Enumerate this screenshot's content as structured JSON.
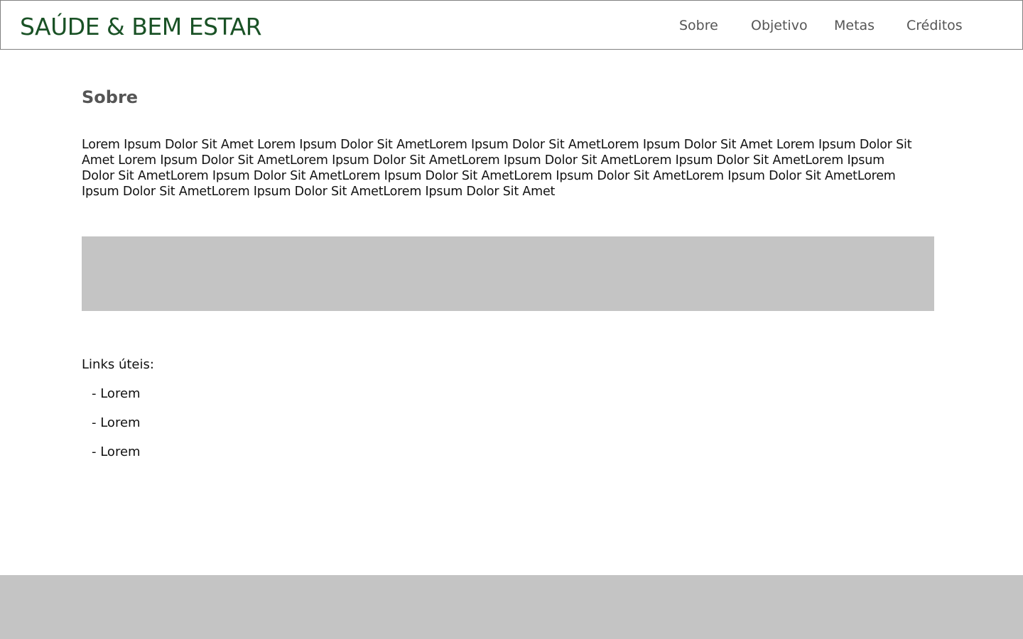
{
  "header": {
    "logo": "SAÚDE & BEM ESTAR",
    "nav": {
      "sobre": "Sobre",
      "objetivo": "Objetivo",
      "metas": "Metas",
      "creditos": "Créditos"
    }
  },
  "main": {
    "section_title": "Sobre",
    "body_text": "Lorem Ipsum Dolor Sit Amet Lorem Ipsum Dolor Sit AmetLorem Ipsum Dolor Sit AmetLorem Ipsum Dolor Sit Amet Lorem Ipsum Dolor Sit Amet Lorem Ipsum Dolor Sit AmetLorem Ipsum Dolor Sit AmetLorem Ipsum Dolor Sit AmetLorem Ipsum Dolor Sit AmetLorem Ipsum Dolor Sit AmetLorem Ipsum Dolor Sit AmetLorem Ipsum Dolor Sit AmetLorem Ipsum Dolor Sit AmetLorem Ipsum Dolor Sit AmetLorem Ipsum Dolor Sit AmetLorem Ipsum Dolor Sit AmetLorem Ipsum Dolor Sit Amet",
    "links_title": "Links úteis:",
    "links": [
      "- Lorem",
      "- Lorem",
      "- Lorem"
    ]
  },
  "colors": {
    "brand": "#1a5226",
    "nav_text": "#555555",
    "placeholder": "#c4c4c4"
  }
}
